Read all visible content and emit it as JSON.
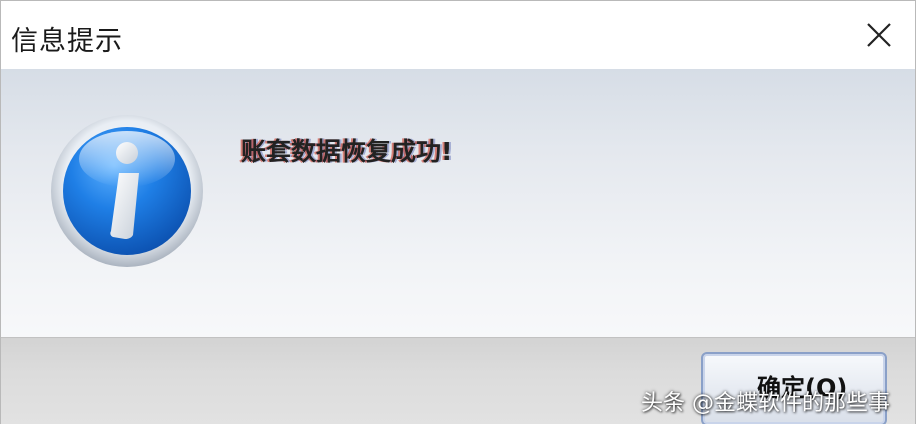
{
  "window": {
    "title": "信息提示",
    "close_icon": "close-icon"
  },
  "body": {
    "icon": "information-icon",
    "message": "账套数据恢复成功!"
  },
  "footer": {
    "ok_label": "确定(O)"
  },
  "watermark": {
    "text": "头条 @金蝶软件的那些事"
  },
  "colors": {
    "icon_blue": "#1a6fd6",
    "button_border": "#8aa0c8",
    "body_gradient_top": "#d6dde6",
    "footer_bg": "#dcdcdc"
  }
}
